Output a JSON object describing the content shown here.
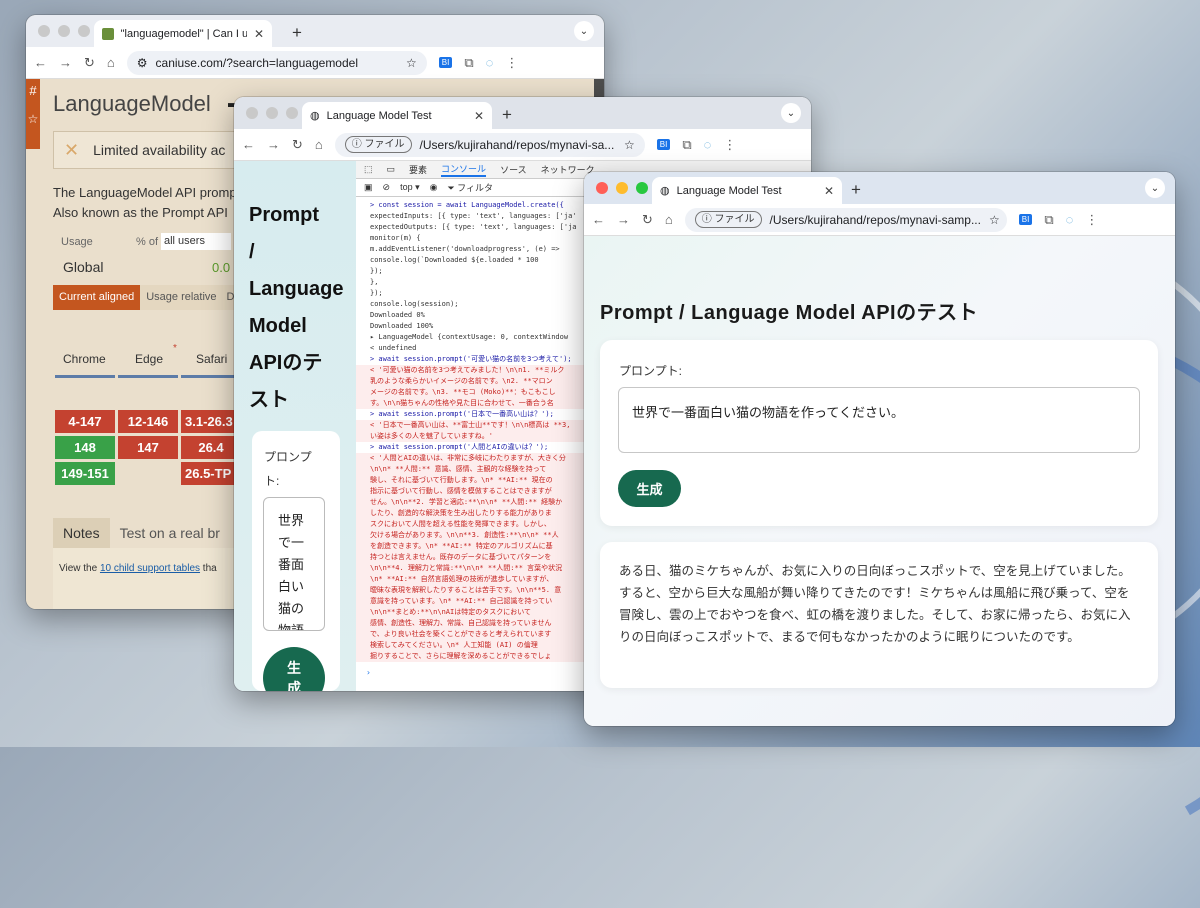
{
  "colors": {
    "accent": "#17694f",
    "caniuse_orange": "#c4561f",
    "red": "#c44230",
    "green": "#39a148"
  },
  "winA": {
    "tab_title": "\"languagemodel\" | Can I use...",
    "url": "caniuse.com/?search=languagemodel",
    "heading": "LanguageModel",
    "availability": "Limited availability ac",
    "desc_line1": "The LanguageModel API promp",
    "desc_line2": "Also known as the Prompt API",
    "usage_label": "Usage",
    "pct_label": "% of",
    "users_select": "all users",
    "global_label": "Global",
    "global_value": "0.0",
    "tab_current": "Current aligned",
    "tab_relative": "Usage relative",
    "tab_d": "D",
    "browsers": [
      "Chrome",
      "Edge",
      "Safari"
    ],
    "chrome_cells": [
      "4-147",
      "148",
      "149-151"
    ],
    "edge_cells": [
      "12-146",
      "147"
    ],
    "safari_cells": [
      "3.1-26.3",
      "26.4",
      "26.5-TP"
    ],
    "notes_tab": "Notes",
    "test_tab": "Test on a real br",
    "footer_pre": "View the ",
    "footer_link": "10 child support tables",
    "footer_post": " tha"
  },
  "winB": {
    "tab_title": "Language Model Test",
    "url_chip": "ファイル",
    "url": "/Users/kujirahand/repos/mynavi-sa...",
    "page_title": [
      "Prompt",
      "/",
      "Language",
      "Model",
      "APIのテ",
      "スト"
    ],
    "prompt_label": [
      "プロンプ",
      "ト:"
    ],
    "textarea_text": [
      "世界",
      "で一",
      "番面",
      "白い",
      "猫の",
      "物語"
    ],
    "gen_button": [
      "生",
      "成"
    ],
    "devtabs": [
      "要素",
      "コンソール",
      "ソース",
      "ネットワーク"
    ],
    "filter_top": "top ▾",
    "filter_label": "フィルタ",
    "console": [
      {
        "cls": "blue",
        "text": "> const session = await LanguageModel.create({"
      },
      {
        "cls": "",
        "text": "    expectedInputs: [{ type: 'text', languages: ['ja'"
      },
      {
        "cls": "",
        "text": "    expectedOutputs: [{ type: 'text', languages: ['ja"
      },
      {
        "cls": "",
        "text": "    monitor(m) {"
      },
      {
        "cls": "",
        "text": "      m.addEventListener('downloadprogress', (e) =>"
      },
      {
        "cls": "",
        "text": "        console.log(`Downloaded ${e.loaded * 100"
      },
      {
        "cls": "",
        "text": "      });"
      },
      {
        "cls": "",
        "text": "    },"
      },
      {
        "cls": "",
        "text": "  });"
      },
      {
        "cls": "",
        "text": "  console.log(session);"
      },
      {
        "cls": "",
        "text": "Downloaded 0%"
      },
      {
        "cls": "",
        "text": "Downloaded 100%"
      },
      {
        "cls": "",
        "text": "▸ LanguageModel {contextUsage: 0, contextWindow"
      },
      {
        "cls": "",
        "text": "< undefined"
      },
      {
        "cls": "blue",
        "text": "> await session.prompt('可愛い猫の名前を3つ考えて');"
      },
      {
        "cls": "red",
        "text": "< '可愛い猫の名前を3つ考えてみました！\\n\\n1. **ミルク"
      },
      {
        "cls": "red",
        "text": "  乳のような柔らかいイメージの名前です。\\n2. **マロン"
      },
      {
        "cls": "red",
        "text": "  メージの名前です。\\n3. **モコ (Moko)**：もこもこし"
      },
      {
        "cls": "red",
        "text": "  す。\\n\\n猫ちゃんの性格や見た目に合わせて、一番合う名"
      },
      {
        "cls": "blue",
        "text": "> await session.prompt('日本で一番高い山は？');"
      },
      {
        "cls": "red",
        "text": "< '日本で一番高い山は、**富士山**です！\\n\\n標高は **3,"
      },
      {
        "cls": "red",
        "text": "  い姿は多くの人を魅了していますね。'"
      },
      {
        "cls": "blue",
        "text": "> await session.prompt('人間とAIの違いは？');"
      },
      {
        "cls": "red",
        "text": "< '人間とAIの違いは、非常に多岐にわたりますが、大きく分"
      },
      {
        "cls": "red",
        "text": "  \\n\\n*   **人間:** 意識、感情、主観的な経験を持って"
      },
      {
        "cls": "red",
        "text": "  験し、それに基づいて行動します。\\n*   **AI:** 現在の"
      },
      {
        "cls": "red",
        "text": "  指示に基づいて行動し、感情を模倣することはできますが"
      },
      {
        "cls": "red",
        "text": "  せん。\\n\\n**2. 学習と適応:**\\n\\n*   **人間:** 経験か"
      },
      {
        "cls": "red",
        "text": "  したり、創造的な解決策を生み出したりする能力がありま"
      },
      {
        "cls": "red",
        "text": "  スクにおいて人間を超える性能を発揮できます。しかし、"
      },
      {
        "cls": "red",
        "text": "  欠ける場合があります。\\n\\n**3. 創造性:**\\n\\n*   **人"
      },
      {
        "cls": "red",
        "text": "  を創造できます。\\n*   **AI:** 特定のアルゴリズムに基"
      },
      {
        "cls": "red",
        "text": "  持つとは言えません。既存のデータに基づいてパターンを"
      },
      {
        "cls": "red",
        "text": "  \\n\\n**4. 理解力と常識:**\\n\\n*   **人間:** 言葉や状況"
      },
      {
        "cls": "red",
        "text": "  \\n*   **AI:** 自然言語処理の技術が進歩していますが、"
      },
      {
        "cls": "red",
        "text": "  曖昧な表現を解釈したりすることは苦手です。\\n\\n**5. 意"
      },
      {
        "cls": "red",
        "text": "  意識を持っています。\\n*   **AI:** 自己認識を持ってい"
      },
      {
        "cls": "red",
        "text": "  \\n\\n**まとめ:**\\n\\nAIは特定のタスクにおいて"
      },
      {
        "cls": "red",
        "text": "  感情、創造性、理解力、常識、自己認識を持っていません"
      },
      {
        "cls": "red",
        "text": "  で、より良い社会を築くことができると考えられています"
      },
      {
        "cls": "red",
        "text": "  検索してみてください。\\n*   人工知能 (AI) の倫理"
      },
      {
        "cls": "red",
        "text": "  掘りすることで、さらに理解を深めることができるでしょ"
      }
    ]
  },
  "winC": {
    "tab_title": "Language Model Test",
    "url_chip": "ファイル",
    "url": "/Users/kujirahand/repos/mynavi-samp...",
    "page_title": "Prompt / Language Model APIのテスト",
    "prompt_label": "プロンプト:",
    "textarea_value": "世界で一番面白い猫の物語を作ってください。",
    "gen_button": "生成",
    "output": "ある日、猫のミケちゃんが、お気に入りの日向ぼっこスポットで、空を見上げていました。すると、空から巨大な風船が舞い降りてきたのです！ミケちゃんは風船に飛び乗って、空を冒険し、雲の上でおやつを食べ、虹の橋を渡りました。そして、お家に帰ったら、お気に入りの日向ぼっこスポットで、まるで何もなかったかのように眠りについたのです。"
  }
}
